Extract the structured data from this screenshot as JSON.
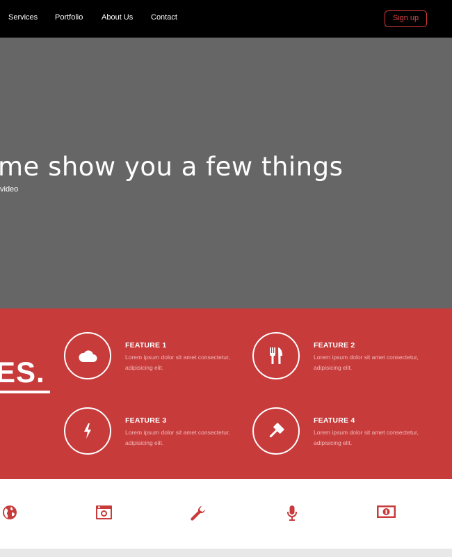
{
  "nav": {
    "links": [
      "Services",
      "Portfolio",
      "About Us",
      "Contact"
    ],
    "signup_label": "Sign up",
    "accent_color": "#e03c3c"
  },
  "hero": {
    "title": "me show you a few things",
    "subtitle": "video",
    "background": "#666666"
  },
  "features": {
    "heading": "ES.",
    "background": "#c83b3b",
    "items": [
      {
        "title": "FEATURE 1",
        "text": "Lorem ipsum dolor sit amet consectetur, adipisicing elit.",
        "icon": "cloud-icon"
      },
      {
        "title": "FEATURE 2",
        "text": "Lorem ipsum dolor sit amet consectetur, adipisicing elit.",
        "icon": "fork-knife-icon"
      },
      {
        "title": "FEATURE 3",
        "text": "Lorem ipsum dolor sit amet consectetur, adipisicing elit.",
        "icon": "bolt-icon"
      },
      {
        "title": "FEATURE 4",
        "text": "Lorem ipsum dolor sit amet consectetur, adipisicing elit.",
        "icon": "gavel-icon"
      }
    ]
  },
  "icon_strip": {
    "icons": [
      "globe-icon",
      "camera-icon",
      "wrench-icon",
      "microphone-icon",
      "money-icon"
    ],
    "color": "#c83b3b"
  }
}
